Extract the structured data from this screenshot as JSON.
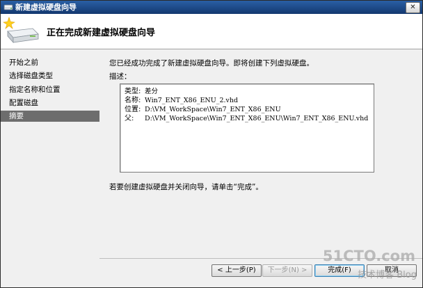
{
  "window": {
    "title": "新建虚拟硬盘向导",
    "close_glyph": "✕"
  },
  "header": {
    "heading": "正在完成新建虚拟硬盘向导",
    "icon": "wizard-disk-icon"
  },
  "sidebar": {
    "items": [
      {
        "label": "开始之前",
        "selected": false
      },
      {
        "label": "选择磁盘类型",
        "selected": false
      },
      {
        "label": "指定名称和位置",
        "selected": false
      },
      {
        "label": "配置磁盘",
        "selected": false
      },
      {
        "label": "摘要",
        "selected": true
      }
    ]
  },
  "main": {
    "intro": "您已经成功完成了新建虚拟硬盘向导。即将创建下列虚拟硬盘。",
    "desc_label": "描述：",
    "summary": [
      {
        "key": "类型:",
        "value": "差分"
      },
      {
        "key": "名称:",
        "value": "Win7_ENT_X86_ENU_2.vhd"
      },
      {
        "key": "位置:",
        "value": "D:\\VM_WorkSpace\\Win7_ENT_X86_ENU"
      },
      {
        "key": "父:",
        "value": "D:\\VM_WorkSpace\\Win7_ENT_X86_ENU\\Win7_ENT_X86_ENU.vhd"
      }
    ],
    "finish_note": "若要创建虚拟硬盘并关闭向导，请单击“完成”。"
  },
  "buttons": {
    "prev": "< 上一步(P)",
    "next": "下一步(N) >",
    "finish": "完成(F)",
    "cancel": "取消"
  },
  "watermark": {
    "main": "51CTO.com",
    "sub": "技术博客 Blog"
  },
  "colors": {
    "titlebar": "#1e4f8f",
    "selected_nav": "#6d6d6d",
    "window_bg": "#f0f0f0"
  }
}
